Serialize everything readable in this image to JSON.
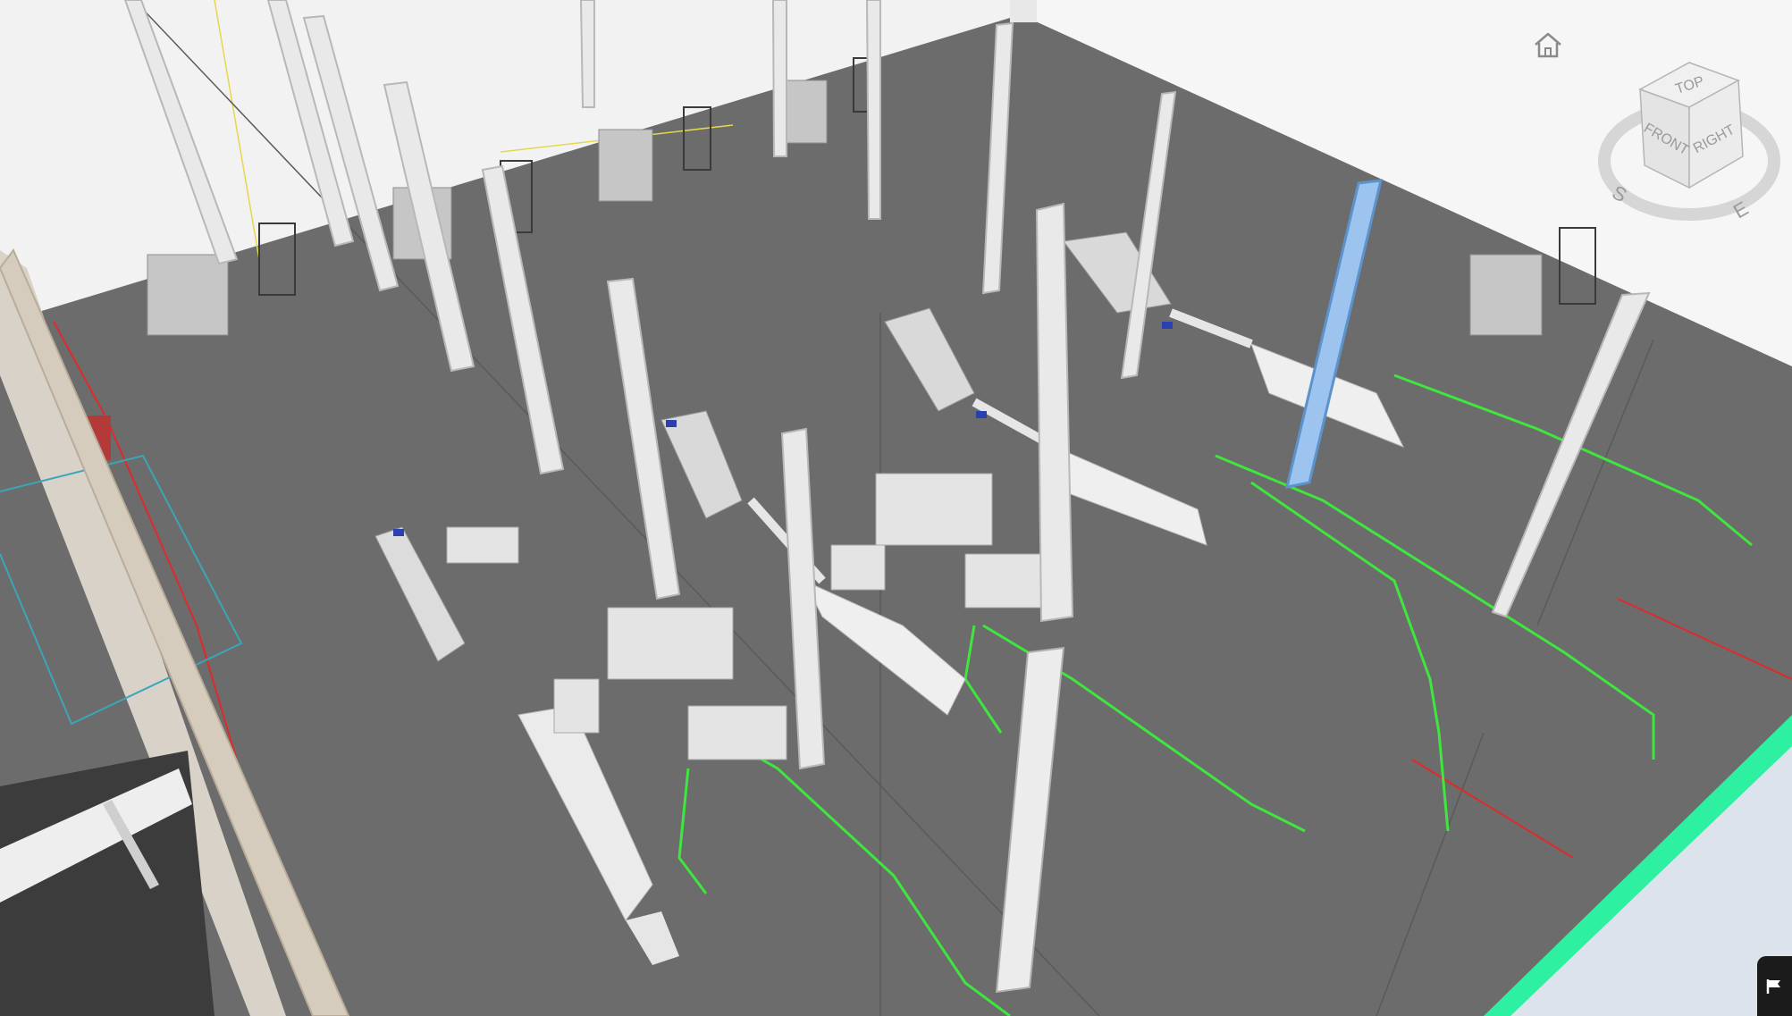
{
  "viewer": {
    "background_floor": "#6b6b6b",
    "wall_color": "#f4f4f4",
    "selected_column_color": "#9cc4ee",
    "pipe_green": "#39e639",
    "pipe_red": "#e02a2a"
  },
  "navigation": {
    "home_icon": "home-icon",
    "viewcube": {
      "top": "TOP",
      "front": "FRONT",
      "right": "RIGHT",
      "compass_s": "S",
      "compass_e": "E"
    }
  },
  "corner_button": {
    "icon": "flag-icon"
  }
}
